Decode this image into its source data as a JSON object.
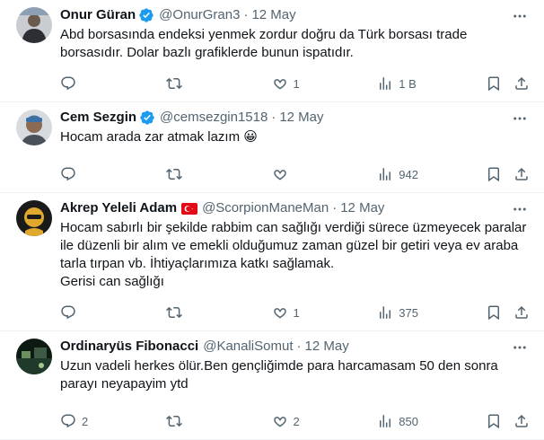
{
  "tweets": [
    {
      "name": "Onur Güran",
      "handle": "@OnurGran3",
      "time": "12 May",
      "verified": true,
      "text": "Abd borsasında endeksi yenmek zordur doğru da Türk borsası trade borsasıdır. Dolar bazlı grafiklerde bunun ispatıdır.",
      "replies": "",
      "retweets": "",
      "likes": "1",
      "views": "1 B"
    },
    {
      "name": "Cem Sezgin",
      "handle": "@cemsezgin1518",
      "time": "12 May",
      "verified": true,
      "text": "Hocam arada zar atmak lazım 😀",
      "replies": "",
      "retweets": "",
      "likes": "",
      "views": "942"
    },
    {
      "name": "Akrep Yeleli Adam",
      "handle": "@ScorpionManeMan",
      "time": "12 May",
      "flag": "turkey-flag",
      "text": "Hocam sabırlı bir şekilde rabbim can sağlığı verdiği sürece üzmeyecek paralar ile düzenli bir alım ve emekli olduğumuz zaman güzel bir getiri veya ev araba tarla tırpan vb. İhtiyaçlarımıza katkı sağlamak.\nGerisi can sağlığı",
      "replies": "",
      "retweets": "",
      "likes": "1",
      "views": "375"
    },
    {
      "name": "Ordinaryüs Fibonacci",
      "handle": "@KanaliSomut",
      "time": "12 May",
      "text": "Uzun vadeli herkes ölür.Ben gençliğimde para harcamasam  50 den sonra parayı neyapayim ytd",
      "replies": "2",
      "retweets": "",
      "likes": "2",
      "views": "850"
    }
  ],
  "separator": "·",
  "colors": {
    "verified": "#1d9bf0",
    "muted": "#536471",
    "text": "#0f1419",
    "divider": "#eff3f4"
  }
}
